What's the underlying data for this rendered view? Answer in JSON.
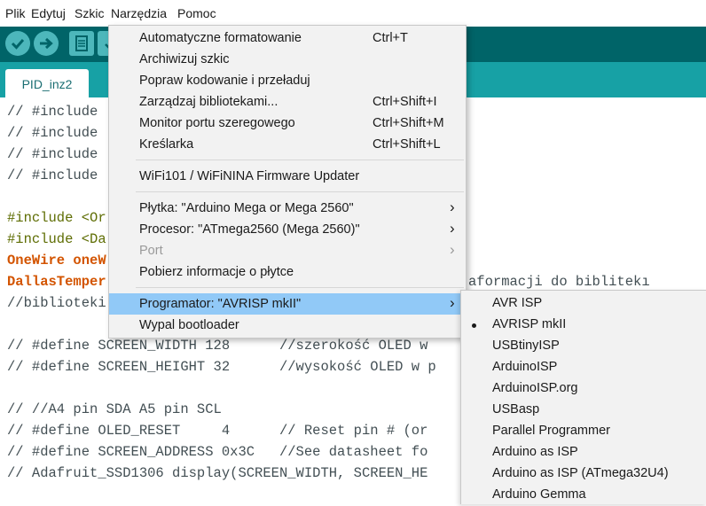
{
  "menubar": {
    "items": [
      "Plik",
      "Edytuj",
      "Szkic",
      "Narzędzia",
      "Pomoc"
    ]
  },
  "tab": {
    "label": "PID_inz2"
  },
  "colors": {
    "toolbar": "#006468",
    "tabstrip": "#17a1a5",
    "highlight": "#91c9f7",
    "orange_type": "#d35400"
  },
  "icons": [
    "verify-icon",
    "upload-icon",
    "new-file-icon",
    "open-icon"
  ],
  "editor": {
    "lines": [
      [
        "// #include "
      ],
      [
        "// #include "
      ],
      [
        "// #include "
      ],
      [
        "// #include "
      ],
      [
        ""
      ],
      [
        "#include <Or"
      ],
      [
        "#include <Da"
      ],
      [
        "OneWire oneW"
      ],
      [
        "DallasTemper"
      ],
      [
        "//biblioteki"
      ],
      [
        ""
      ],
      [
        "// #define SCREEN_WIDTH 128      //szerokość OLED w"
      ],
      [
        "// #define SCREEN_HEIGHT 32      //wysokość OLED w p"
      ],
      [
        ""
      ],
      [
        "// //A4 pin SDA A5 pin SCL"
      ],
      [
        "// #define OLED_RESET     4      // Reset pin # (or"
      ],
      [
        "// #define SCREEN_ADDRESS 0x3C   //See datasheet fo"
      ],
      [
        "// Adafruit_SSD1306 display(SCREEN_WIDTH, SCREEN_HE"
      ]
    ],
    "partial_right": "aformacji do biblitekı"
  },
  "tools_menu": {
    "items": [
      {
        "label": "Automatyczne formatowanie",
        "shortcut": "Ctrl+T"
      },
      {
        "label": "Archiwizuj szkic",
        "shortcut": ""
      },
      {
        "label": "Popraw kodowanie i przeładuj",
        "shortcut": ""
      },
      {
        "label": "Zarządzaj bibliotekami...",
        "shortcut": "Ctrl+Shift+I"
      },
      {
        "label": "Monitor portu szeregowego",
        "shortcut": "Ctrl+Shift+M"
      },
      {
        "label": "Kreślarka",
        "shortcut": "Ctrl+Shift+L"
      },
      {
        "label": "WiFi101 / WiFiNINA Firmware Updater",
        "shortcut": ""
      },
      {
        "label": "Płytka: \"Arduino Mega or Mega 2560\"",
        "submenu": true
      },
      {
        "label": "Procesor: \"ATmega2560 (Mega 2560)\"",
        "submenu": true
      },
      {
        "label": "Port",
        "submenu": true,
        "disabled": true
      },
      {
        "label": "Pobierz informacje o płytce",
        "shortcut": ""
      },
      {
        "label": "Programator: \"AVRISP mkII\"",
        "submenu": true,
        "highlighted": true
      },
      {
        "label": "Wypal bootloader",
        "shortcut": ""
      }
    ]
  },
  "programmer_submenu": {
    "selected": "AVRISP mkII",
    "items": [
      "AVR ISP",
      "AVRISP mkII",
      "USBtinyISP",
      "ArduinoISP",
      "ArduinoISP.org",
      "USBasp",
      "Parallel Programmer",
      "Arduino as ISP",
      "Arduino as ISP (ATmega32U4)",
      "Arduino Gemma"
    ]
  }
}
